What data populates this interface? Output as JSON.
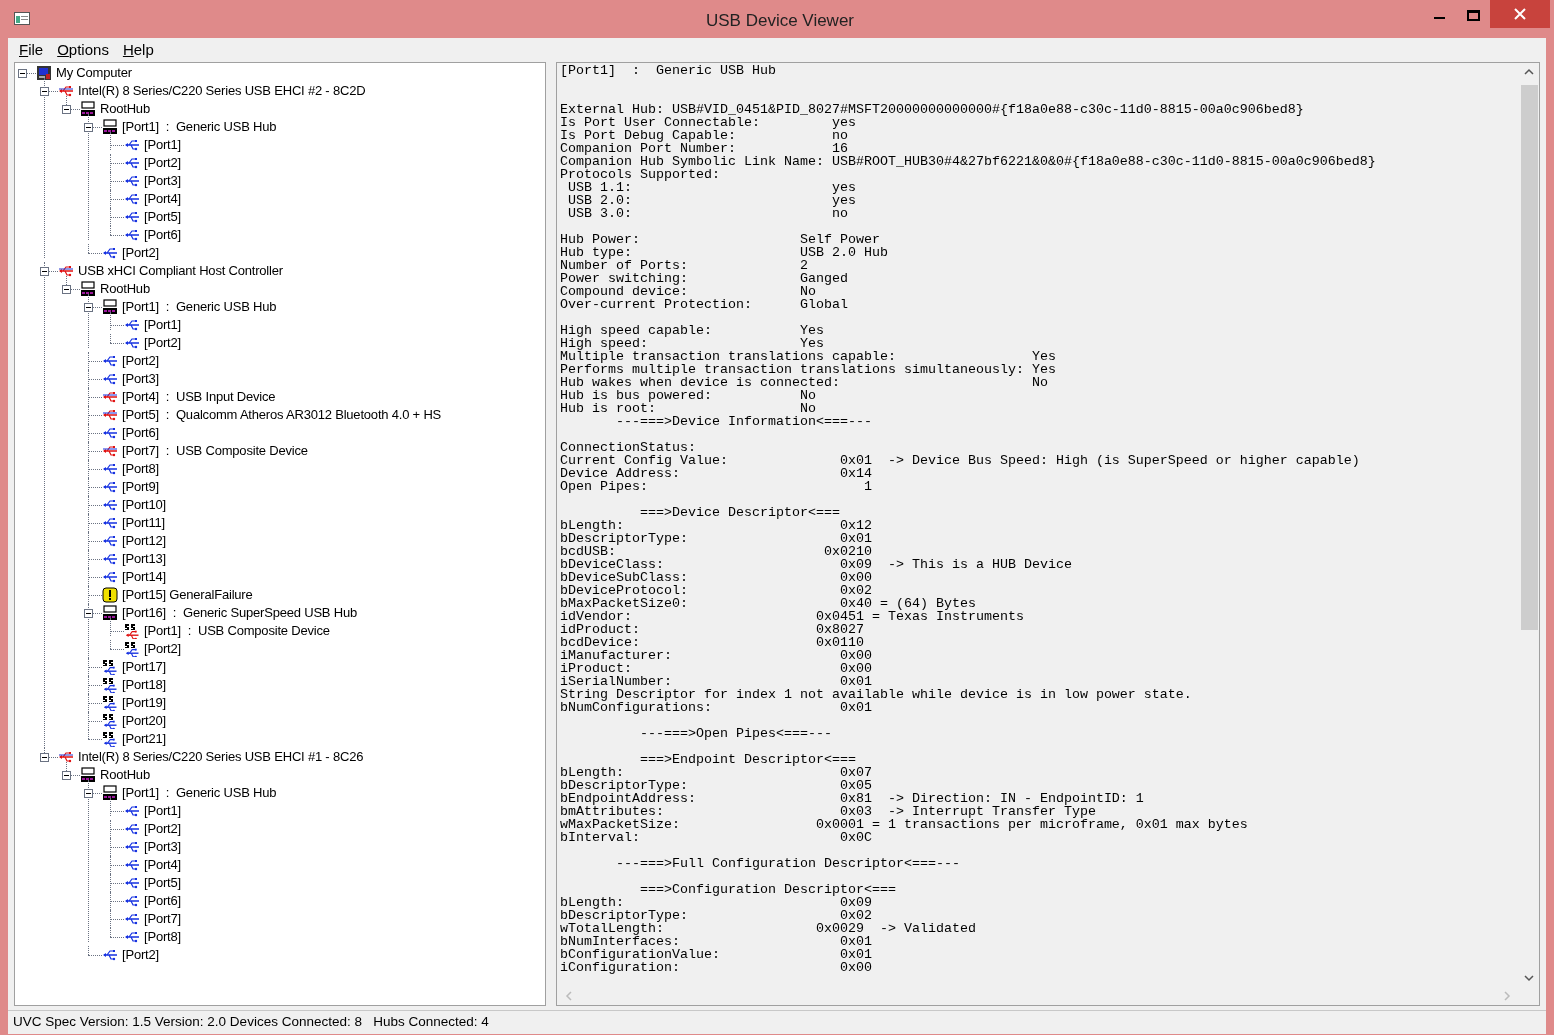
{
  "window": {
    "title": "USB Device Viewer"
  },
  "menu": [
    "File",
    "Options",
    "Help"
  ],
  "tree": [
    {
      "label": "My Computer",
      "kind": "computer",
      "expanded": true,
      "children": [
        {
          "label": "Intel(R) 8 Series/C220 Series USB EHCI #2 - 8C2D",
          "kind": "controller",
          "expanded": true,
          "children": [
            {
              "label": "RootHub",
              "kind": "hub",
              "expanded": true,
              "children": [
                {
                  "label": "[Port1]  :  Generic USB Hub",
                  "kind": "hub",
                  "expanded": true,
                  "children": [
                    {
                      "label": "[Port1]",
                      "kind": "port"
                    },
                    {
                      "label": "[Port2]",
                      "kind": "port"
                    },
                    {
                      "label": "[Port3]",
                      "kind": "port"
                    },
                    {
                      "label": "[Port4]",
                      "kind": "port"
                    },
                    {
                      "label": "[Port5]",
                      "kind": "port"
                    },
                    {
                      "label": "[Port6]",
                      "kind": "port"
                    }
                  ]
                },
                {
                  "label": "[Port2]",
                  "kind": "port"
                }
              ]
            }
          ]
        },
        {
          "label": "USB xHCI Compliant Host Controller",
          "kind": "controller",
          "expanded": true,
          "children": [
            {
              "label": "RootHub",
              "kind": "hub",
              "expanded": true,
              "children": [
                {
                  "label": "[Port1]  :  Generic USB Hub",
                  "kind": "hub",
                  "expanded": true,
                  "children": [
                    {
                      "label": "[Port1]",
                      "kind": "port"
                    },
                    {
                      "label": "[Port2]",
                      "kind": "port"
                    }
                  ]
                },
                {
                  "label": "[Port2]",
                  "kind": "port"
                },
                {
                  "label": "[Port3]",
                  "kind": "port"
                },
                {
                  "label": "[Port4]  :  USB Input Device",
                  "kind": "device"
                },
                {
                  "label": "[Port5]  :  Qualcomm Atheros AR3012 Bluetooth 4.0 + HS",
                  "kind": "device"
                },
                {
                  "label": "[Port6]",
                  "kind": "port"
                },
                {
                  "label": "[Port7]  :  USB Composite Device",
                  "kind": "device"
                },
                {
                  "label": "[Port8]",
                  "kind": "port"
                },
                {
                  "label": "[Port9]",
                  "kind": "port"
                },
                {
                  "label": "[Port10]",
                  "kind": "port"
                },
                {
                  "label": "[Port11]",
                  "kind": "port"
                },
                {
                  "label": "[Port12]",
                  "kind": "port"
                },
                {
                  "label": "[Port13]",
                  "kind": "port"
                },
                {
                  "label": "[Port14]",
                  "kind": "port"
                },
                {
                  "label": "[Port15] GeneralFailure",
                  "kind": "failure"
                },
                {
                  "label": "[Port16]  :  Generic SuperSpeed USB Hub",
                  "kind": "hub",
                  "expanded": true,
                  "children": [
                    {
                      "label": "[Port1]  :  USB Composite Device",
                      "kind": "ss-device"
                    },
                    {
                      "label": "[Port2]",
                      "kind": "ss-port"
                    }
                  ]
                },
                {
                  "label": "[Port17]",
                  "kind": "ss-port"
                },
                {
                  "label": "[Port18]",
                  "kind": "ss-port"
                },
                {
                  "label": "[Port19]",
                  "kind": "ss-port"
                },
                {
                  "label": "[Port20]",
                  "kind": "ss-port"
                },
                {
                  "label": "[Port21]",
                  "kind": "ss-port"
                }
              ]
            }
          ]
        },
        {
          "label": "Intel(R) 8 Series/C220 Series USB EHCI #1 - 8C26",
          "kind": "controller",
          "expanded": true,
          "children": [
            {
              "label": "RootHub",
              "kind": "hub",
              "expanded": true,
              "children": [
                {
                  "label": "[Port1]  :  Generic USB Hub",
                  "kind": "hub",
                  "expanded": true,
                  "children": [
                    {
                      "label": "[Port1]",
                      "kind": "port"
                    },
                    {
                      "label": "[Port2]",
                      "kind": "port"
                    },
                    {
                      "label": "[Port3]",
                      "kind": "port"
                    },
                    {
                      "label": "[Port4]",
                      "kind": "port"
                    },
                    {
                      "label": "[Port5]",
                      "kind": "port"
                    },
                    {
                      "label": "[Port6]",
                      "kind": "port"
                    },
                    {
                      "label": "[Port7]",
                      "kind": "port"
                    },
                    {
                      "label": "[Port8]",
                      "kind": "port"
                    }
                  ]
                },
                {
                  "label": "[Port2]",
                  "kind": "port"
                }
              ]
            }
          ]
        }
      ]
    }
  ],
  "details": [
    {
      "kind": "title",
      "lines": [
        "[Port1]  :  Generic USB Hub"
      ]
    },
    {
      "kind": "block",
      "lines": [
        "External Hub: USB#VID_0451&PID_8027#MSFT20000000000000#{f18a0e88-c30c-11d0-8815-00a0c906bed8}",
        "Is Port User Connectable:         yes",
        "Is Port Debug Capable:            no",
        "Companion Port Number:            16",
        "Companion Hub Symbolic Link Name: USB#ROOT_HUB30#4&27bf6221&0&0#{f18a0e88-c30c-11d0-8815-00a0c906bed8}",
        "Protocols Supported:",
        " USB 1.1:                         yes",
        " USB 2.0:                         yes",
        " USB 3.0:                         no"
      ]
    },
    {
      "kind": "block",
      "lines": [
        "Hub Power:                    Self Power",
        "Hub type:                     USB 2.0 Hub",
        "Number of Ports:              2",
        "Power switching:              Ganged",
        "Compound device:              No",
        "Over-current Protection:      Global"
      ]
    },
    {
      "kind": "block",
      "lines": [
        "High speed capable:           Yes",
        "High speed:                   Yes",
        "Multiple transaction translations capable:                 Yes",
        "Performs multiple transaction translations simultaneously: Yes",
        "Hub wakes when device is connected:                        No",
        "Hub is bus powered:           No",
        "Hub is root:                  No",
        "       ---===>Device Information<===---"
      ]
    },
    {
      "kind": "block",
      "lines": [
        "ConnectionStatus:",
        "Current Config Value:              0x01  -> Device Bus Speed: High (is SuperSpeed or higher capable)",
        "Device Address:                    0x14",
        "Open Pipes:                           1"
      ]
    },
    {
      "kind": "block",
      "lines": [
        "          ===>Device Descriptor<===",
        "bLength:                           0x12",
        "bDescriptorType:                   0x01",
        "bcdUSB:                          0x0210",
        "bDeviceClass:                      0x09  -> This is a HUB Device",
        "bDeviceSubClass:                   0x00",
        "bDeviceProtocol:                   0x02",
        "bMaxPacketSize0:                   0x40 = (64) Bytes",
        "idVendor:                       0x0451 = Texas Instruments",
        "idProduct:                      0x8027",
        "bcdDevice:                      0x0110",
        "iManufacturer:                     0x00",
        "iProduct:                          0x00",
        "iSerialNumber:                     0x01",
        "String Descriptor for index 1 not available while device is in low power state.",
        "bNumConfigurations:                0x01"
      ]
    },
    {
      "kind": "block",
      "lines": [
        "          ---===>Open Pipes<===---"
      ]
    },
    {
      "kind": "block",
      "lines": [
        "          ===>Endpoint Descriptor<===",
        "bLength:                           0x07",
        "bDescriptorType:                   0x05",
        "bEndpointAddress:                  0x81  -> Direction: IN - EndpointID: 1",
        "bmAttributes:                      0x03  -> Interrupt Transfer Type",
        "wMaxPacketSize:                 0x0001 = 1 transactions per microframe, 0x01 max bytes",
        "bInterval:                         0x0C"
      ]
    },
    {
      "kind": "block",
      "lines": [
        "       ---===>Full Configuration Descriptor<===---"
      ]
    },
    {
      "kind": "block",
      "lines": [
        "          ===>Configuration Descriptor<===",
        "bLength:                           0x09",
        "bDescriptorType:                   0x02",
        "wTotalLength:                   0x0029  -> Validated",
        "bNumInterfaces:                    0x01",
        "bConfigurationValue:               0x01",
        "iConfiguration:                    0x00"
      ]
    }
  ],
  "status_bar": "UVC Spec Version: 1.5 Version: 2.0 Devices Connected: 8   Hubs Connected: 4"
}
